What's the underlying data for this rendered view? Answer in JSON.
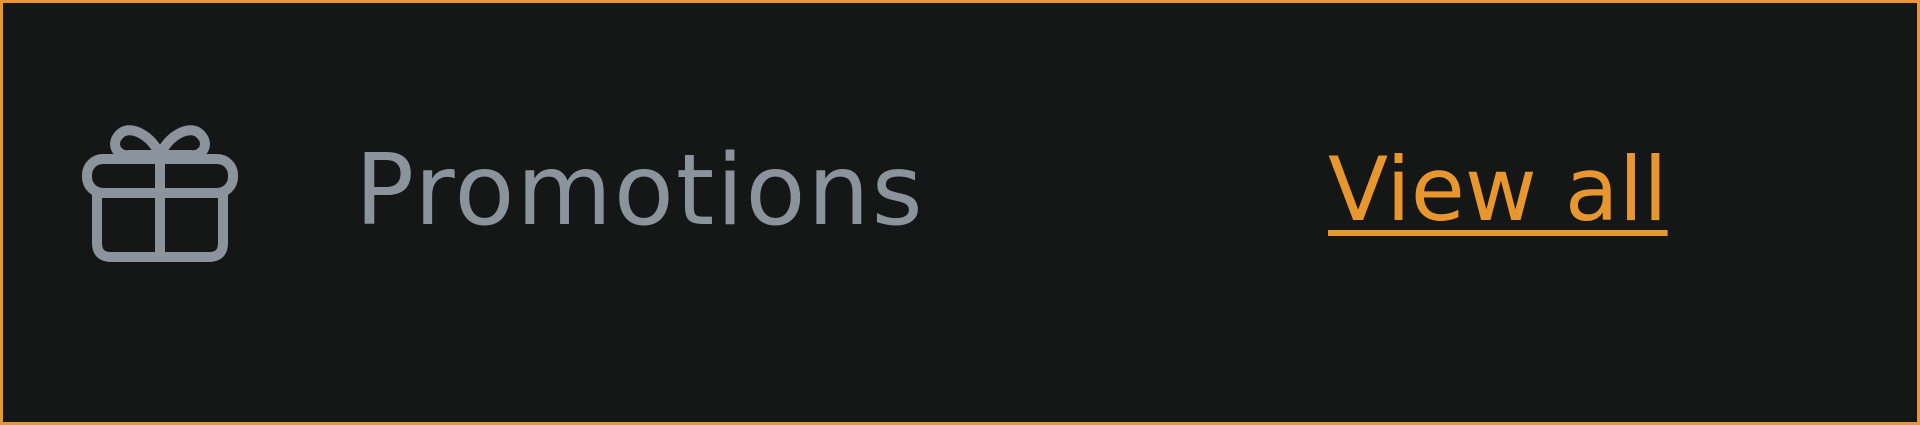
{
  "promotions": {
    "icon": "gift-icon",
    "title": "Promotions",
    "view_all_label": "View all"
  },
  "colors": {
    "background": "#151716",
    "accent": "#e8962e",
    "muted_text": "#8b939d"
  }
}
